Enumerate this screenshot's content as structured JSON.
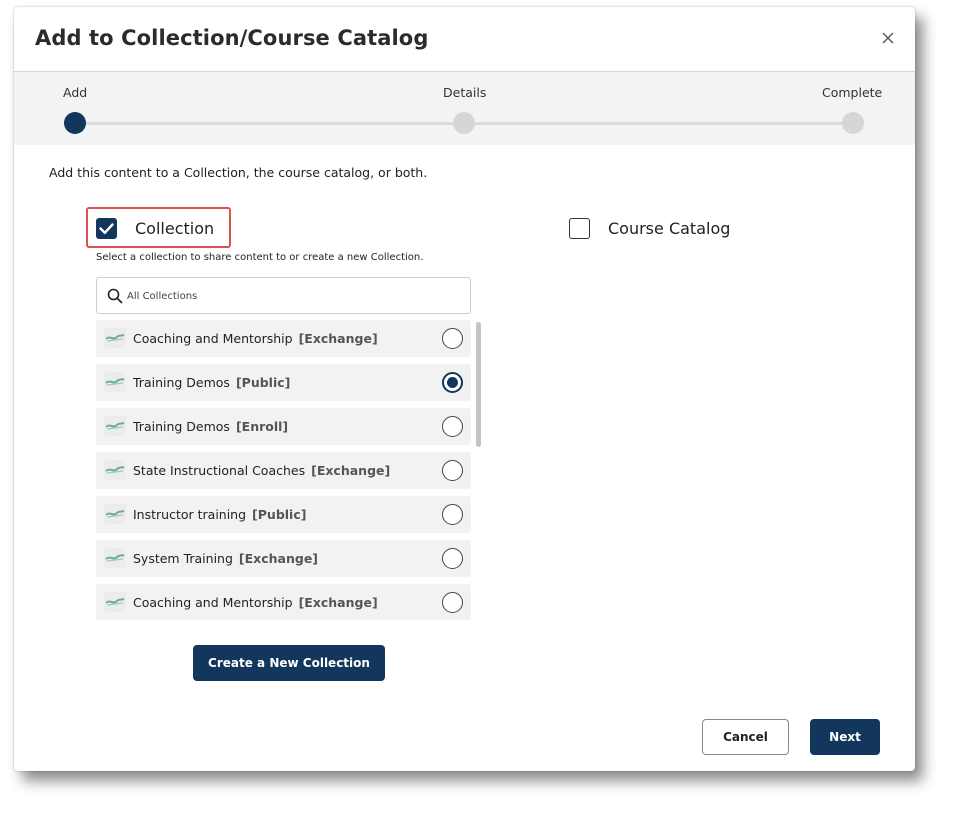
{
  "dialog": {
    "title": "Add to Collection/Course Catalog",
    "close_icon": "close-icon"
  },
  "stepper": {
    "steps": [
      {
        "label": "Add",
        "active": true
      },
      {
        "label": "Details",
        "active": false
      },
      {
        "label": "Complete",
        "active": false
      }
    ]
  },
  "intro_text": "Add this content to a Collection, the course catalog, or both.",
  "collection": {
    "label": "Collection",
    "checked": true,
    "subtext": "Select a collection to share content to or create a new Collection.",
    "search_placeholder": "All Collections",
    "items": [
      {
        "name": "Coaching and Mentorship",
        "tag": "[Exchange]",
        "selected": false
      },
      {
        "name": "Training Demos",
        "tag": "[Public]",
        "selected": true
      },
      {
        "name": "Training Demos",
        "tag": "[Enroll]",
        "selected": false
      },
      {
        "name": "State Instructional Coaches",
        "tag": "[Exchange]",
        "selected": false
      },
      {
        "name": "Instructor training",
        "tag": "[Public]",
        "selected": false
      },
      {
        "name": "System Training",
        "tag": "[Exchange]",
        "selected": false
      },
      {
        "name": "Coaching and Mentorship",
        "tag": "[Exchange]",
        "selected": false
      }
    ],
    "create_button": "Create a New Collection"
  },
  "course_catalog": {
    "label": "Course Catalog",
    "checked": false
  },
  "footer": {
    "cancel_label": "Cancel",
    "next_label": "Next"
  },
  "colors": {
    "primary": "#12365c",
    "highlight": "#d9534f"
  }
}
